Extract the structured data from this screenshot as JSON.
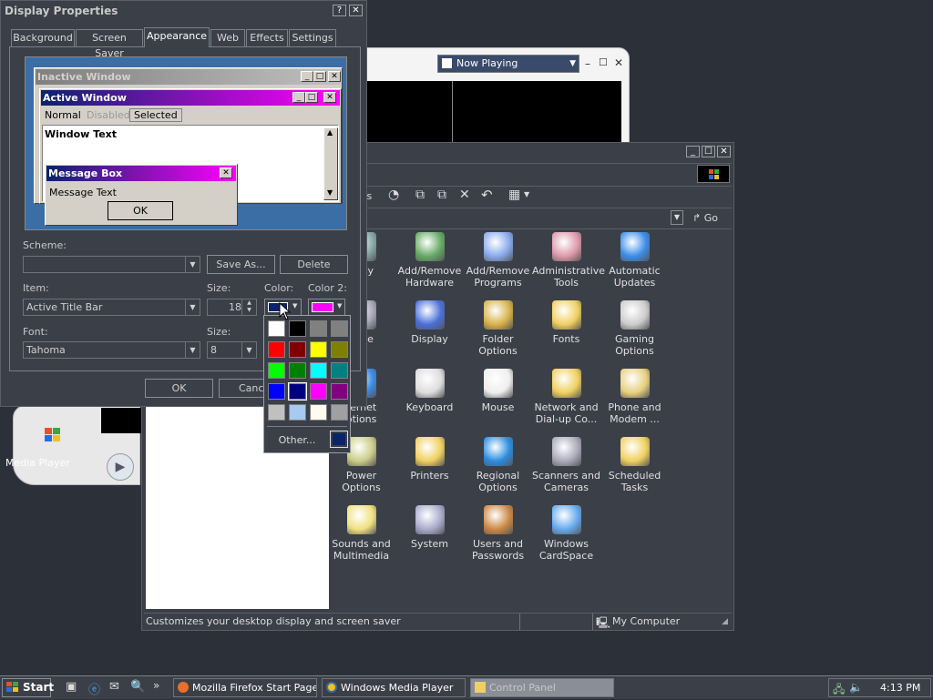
{
  "display_properties": {
    "title": "Display Properties",
    "tabs": [
      "Background",
      "Screen Saver",
      "Appearance",
      "Web",
      "Effects",
      "Settings"
    ],
    "preview": {
      "inactive_title": "Inactive Window",
      "active_title": "Active Window",
      "menu": [
        "Normal",
        "Disabled",
        "Selected"
      ],
      "window_text": "Window Text",
      "message_title": "Message Box",
      "message_text": "Message Text",
      "ok": "OK"
    },
    "scheme_label": "Scheme:",
    "scheme_value": "",
    "save_as": "Save As...",
    "delete": "Delete",
    "item_label": "Item:",
    "item_value": "Active Title Bar",
    "size_label": "Size:",
    "size_value": "18",
    "color_label": "Color:",
    "color2_label": "Color 2:",
    "font_label": "Font:",
    "font_value": "Tahoma",
    "font_size_label": "Size:",
    "font_size_value": "8",
    "ok": "OK",
    "cancel": "Cancel",
    "color1": "#0a246a",
    "color2": "#ff00ff"
  },
  "color_picker": {
    "swatches": [
      "#ffffff",
      "#000000",
      "#808080",
      "#808080",
      "#ff0000",
      "#800000",
      "#ffff00",
      "#808000",
      "#00ff00",
      "#008000",
      "#00ffff",
      "#008080",
      "#0000ff",
      "#000080",
      "#ff00ff",
      "#800080",
      "#c0c0c0",
      "#a6caf0",
      "#fffbf0",
      "#a0a0a4"
    ],
    "other": "Other...",
    "current": "#0a246a"
  },
  "media_player": {
    "title": "Now Playing",
    "desktop_label": "Media Player"
  },
  "control_panel": {
    "toolbar_text": "rs",
    "go": "Go",
    "status_text": "Customizes your desktop display and screen saver",
    "status_location": "My Computer",
    "items": [
      {
        "label": "bility\nns",
        "icon": "accessibility-icon"
      },
      {
        "label": "Add/Remove\nHardware",
        "icon": "add-hardware-icon"
      },
      {
        "label": "Add/Remove\nPrograms",
        "icon": "add-programs-icon"
      },
      {
        "label": "Administrative\nTools",
        "icon": "admin-tools-icon"
      },
      {
        "label": "Automatic\nUpdates",
        "icon": "windows-update-icon"
      },
      {
        "label": "Time",
        "icon": "date-time-icon"
      },
      {
        "label": "Display",
        "icon": "display-icon"
      },
      {
        "label": "Folder Options",
        "icon": "folder-options-icon"
      },
      {
        "label": "Fonts",
        "icon": "fonts-icon"
      },
      {
        "label": "Gaming\nOptions",
        "icon": "gaming-icon"
      },
      {
        "label": "ternet\nptions",
        "icon": "internet-options-icon"
      },
      {
        "label": "Keyboard",
        "icon": "keyboard-icon"
      },
      {
        "label": "Mouse",
        "icon": "mouse-icon"
      },
      {
        "label": "Network and\nDial-up Co...",
        "icon": "network-icon"
      },
      {
        "label": "Phone and\nModem ...",
        "icon": "phone-icon"
      },
      {
        "label": "Power Options",
        "icon": "power-icon"
      },
      {
        "label": "Printers",
        "icon": "printers-icon"
      },
      {
        "label": "Regional\nOptions",
        "icon": "regional-icon"
      },
      {
        "label": "Scanners and\nCameras",
        "icon": "scanner-icon"
      },
      {
        "label": "Scheduled\nTasks",
        "icon": "scheduled-tasks-icon"
      },
      {
        "label": "Sounds and\nMultimedia",
        "icon": "sounds-icon"
      },
      {
        "label": "System",
        "icon": "system-icon"
      },
      {
        "label": "Users and\nPasswords",
        "icon": "users-icon"
      },
      {
        "label": "Windows\nCardSpace",
        "icon": "cardspace-icon"
      }
    ]
  },
  "taskbar": {
    "start": "Start",
    "tasks": [
      "Mozilla Firefox Start Page...",
      "Windows Media Player",
      "Control Panel"
    ],
    "clock": "4:13 PM"
  }
}
